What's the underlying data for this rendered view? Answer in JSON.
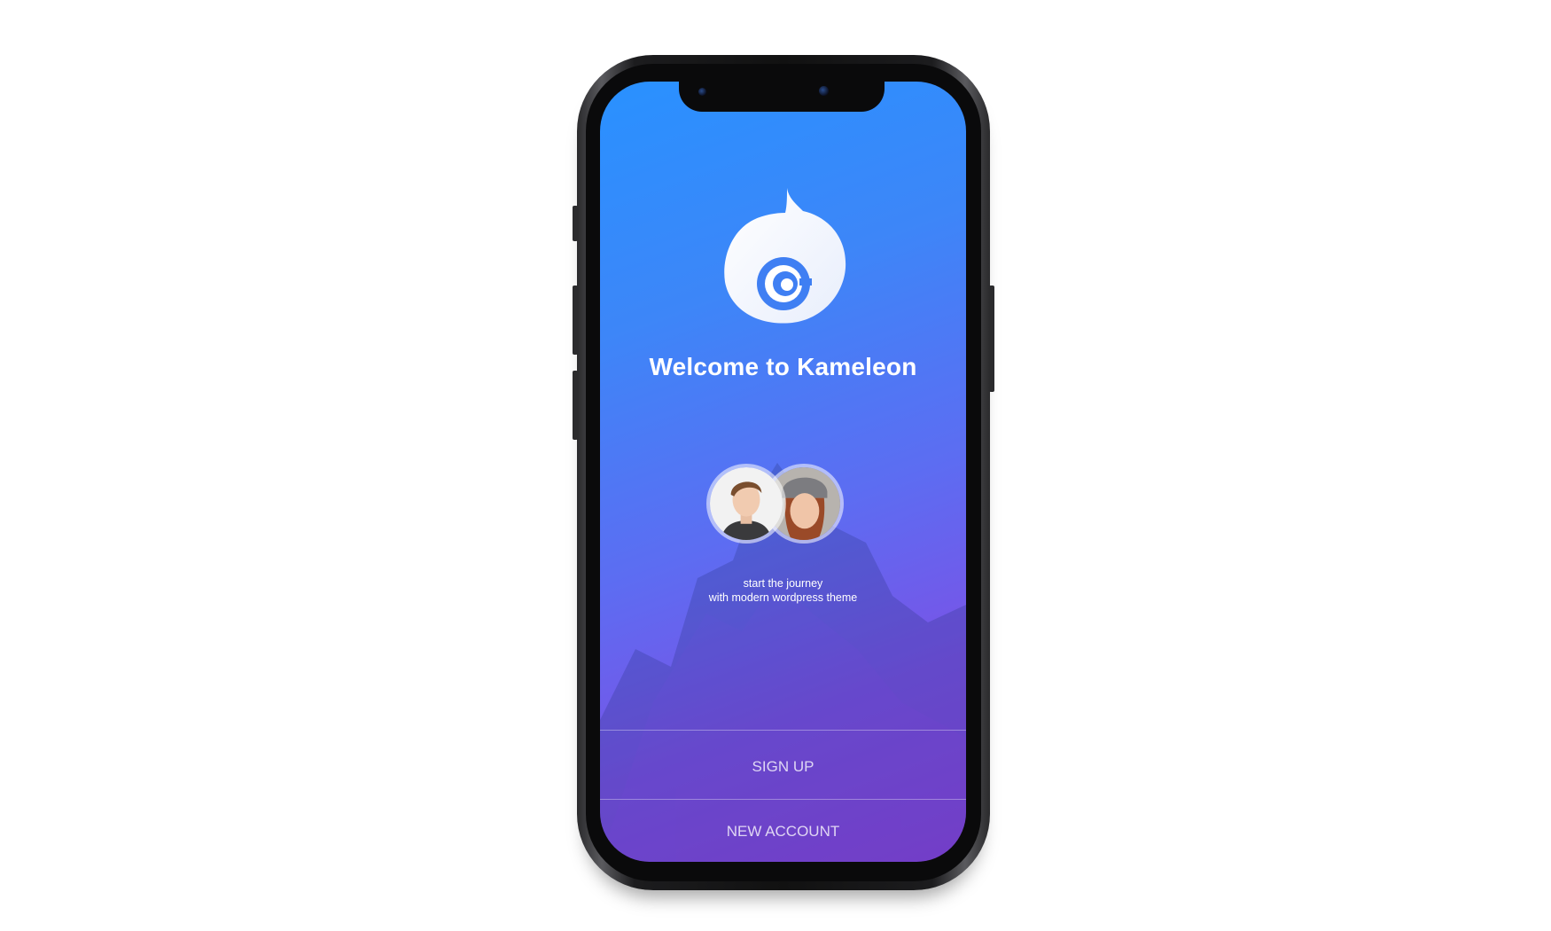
{
  "app": {
    "name": "Kameleon",
    "welcome_title": "Welcome to Kameleon",
    "tagline_line1": "start the journey",
    "tagline_line2": "with modern wordpress theme"
  },
  "actions": {
    "primary_label": "SIGN UP",
    "secondary_label": "NEW ACCOUNT"
  },
  "colors": {
    "gradient_top": "#2991ff",
    "gradient_bottom": "#8a45e0",
    "text": "#ffffff",
    "device_frame": "#111111"
  },
  "icons": {
    "logo": "chameleon-swirl-logo",
    "avatar_1": "avatar-man",
    "avatar_2": "avatar-woman"
  }
}
